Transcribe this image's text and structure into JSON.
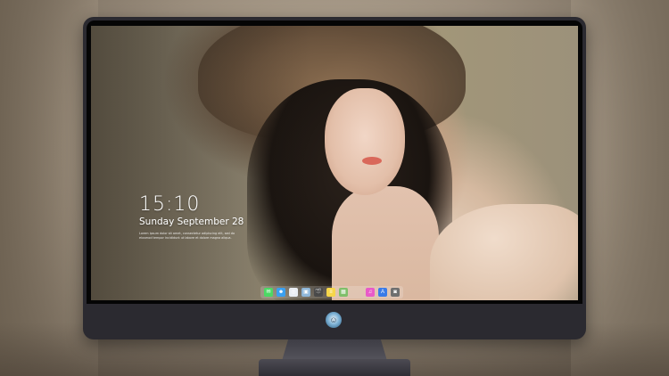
{
  "lock_screen": {
    "time": "15:10",
    "date": "Sunday September 28",
    "caption": "Lorem ipsum dolor sit amet, consectetur adipiscing elit, sed do eiusmod tempor incididunt ut labore et dolore magna aliqua."
  },
  "dock": {
    "apps": [
      {
        "name": "messages",
        "icon": "messages-icon",
        "color": "#4cd964",
        "glyph": "✉"
      },
      {
        "name": "finder",
        "icon": "finder-icon",
        "color": "#3aa0f0",
        "glyph": "☻"
      },
      {
        "name": "safari",
        "icon": "safari-icon",
        "color": "#e9eef3",
        "glyph": "◎"
      },
      {
        "name": "preview",
        "icon": "preview-icon",
        "color": "#8fb7d9",
        "glyph": "▣"
      },
      {
        "name": "imovie",
        "icon": "clapper-icon",
        "color": "#4a4a4a",
        "glyph": "🎬"
      },
      {
        "name": "notes",
        "icon": "notes-icon",
        "color": "#f6d64a",
        "glyph": "≡"
      },
      {
        "name": "photos",
        "icon": "photos-icon",
        "color": "#7fbf6a",
        "glyph": "▦"
      },
      {
        "name": "itunes",
        "icon": "music-icon",
        "color": "#e85ac8",
        "glyph": "♫"
      },
      {
        "name": "app-store",
        "icon": "app-store-icon",
        "color": "#3a7be8",
        "glyph": "A"
      },
      {
        "name": "camera",
        "icon": "camera-icon",
        "color": "#6f6f6f",
        "glyph": "◙"
      }
    ]
  },
  "colors": {
    "bezel": "#2b2a30",
    "screen_text": "#ffffff"
  }
}
